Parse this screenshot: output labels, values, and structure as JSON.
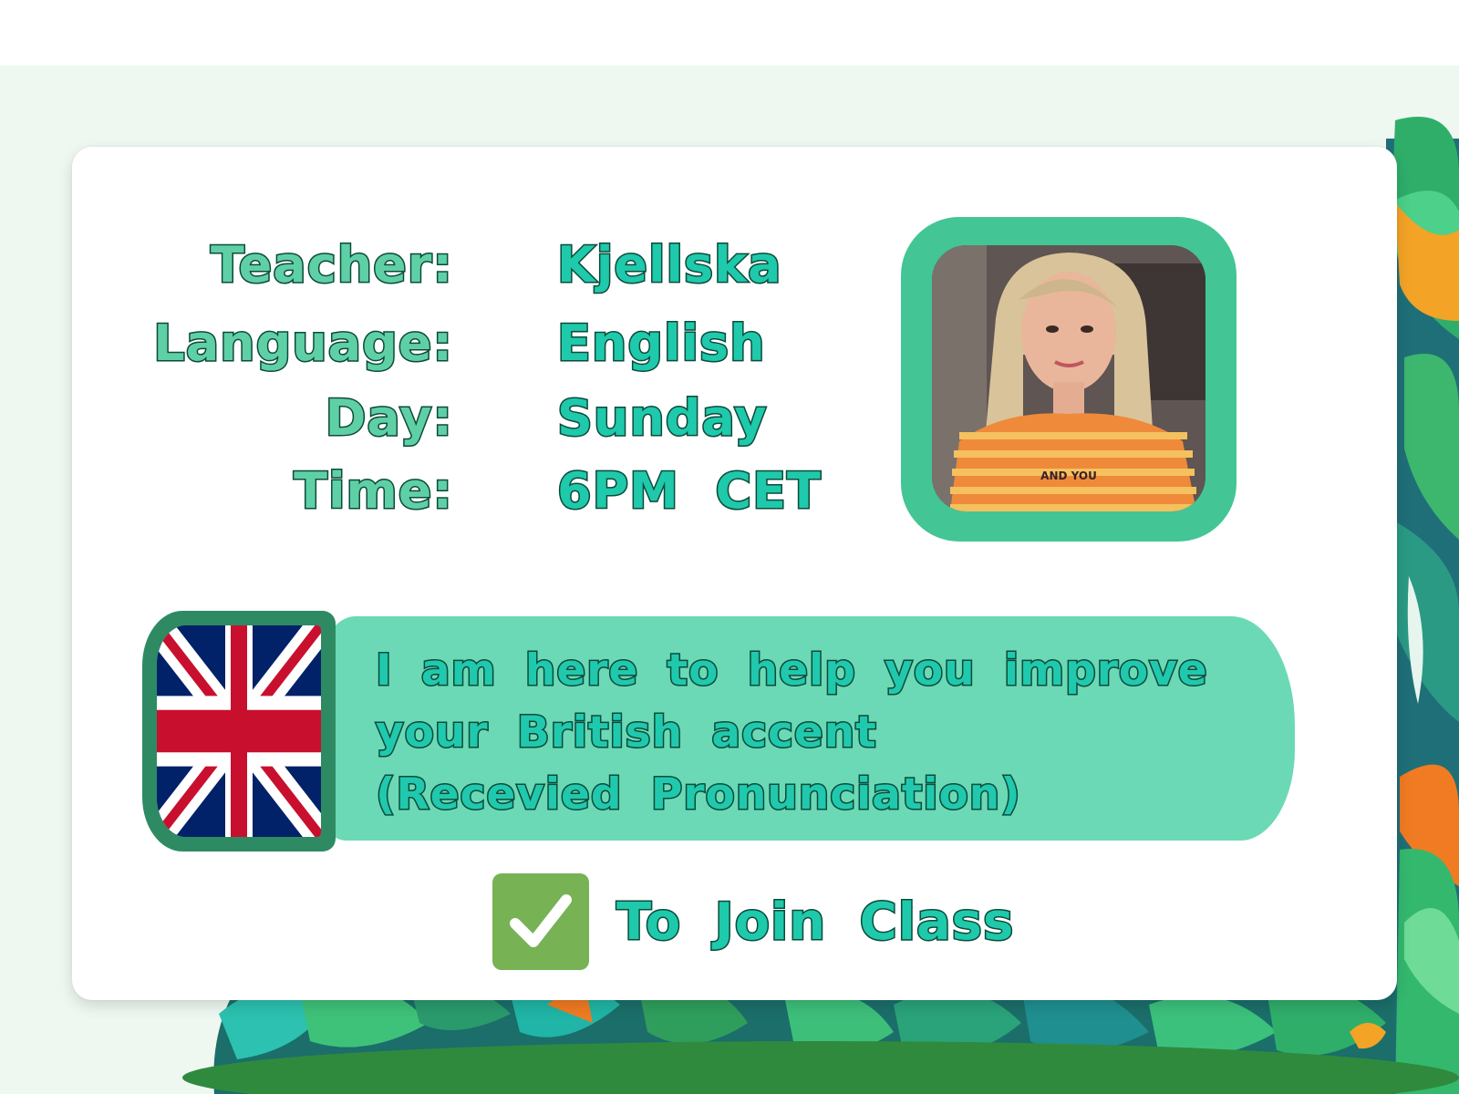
{
  "teacher": {
    "label": "Teacher:",
    "value": "Kjellska"
  },
  "language": {
    "label": "Language:",
    "value": "English"
  },
  "day": {
    "label": "Day:",
    "value": "Sunday"
  },
  "time": {
    "label": "Time:",
    "value": "6PM  CET"
  },
  "photo": {
    "shirt_text": "AND YOU"
  },
  "banner": {
    "line1": "I am here to help you improve",
    "line2": "your British accent",
    "line3": "(Recevied Pronunciation)"
  },
  "join": {
    "label": "To Join Class",
    "icon": "check-mark-button-icon"
  },
  "flag": {
    "icon": "uk-flag-icon"
  },
  "colors": {
    "accent_green": "#43c595",
    "banner_green": "#6bd9b5",
    "value_teal": "#1fc9ab",
    "label_mint": "#5fd0a6",
    "check_green": "#77b255",
    "background": "#eef8f1"
  }
}
